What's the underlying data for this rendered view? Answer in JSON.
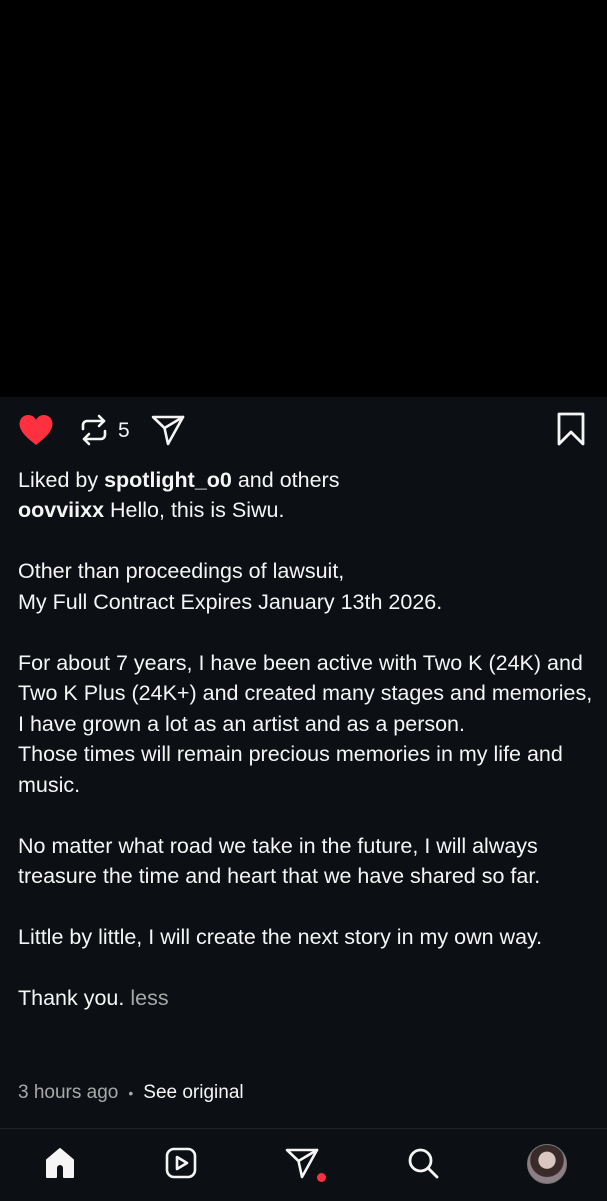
{
  "post": {
    "repost_count": "5",
    "liked_by_prefix": "Liked by ",
    "liked_by_user": "spotlight_o0",
    "liked_by_suffix": " and others",
    "author": "oovviixx",
    "caption_first": " Hello, this is Siwu.",
    "paragraphs": [
      "Other than proceedings of lawsuit,\nMy Full Contract Expires January 13th 2026.",
      "For about 7 years, I have been active with Two K (24K) and Two K Plus (24K+) and created many stages and memories,\nI have grown a lot as an artist and as a person.\nThose times will remain precious memories in my life and music.",
      "No matter what road we take in the future, I will always treasure the time and heart that we have shared so far.",
      "Little by little, I will create the next story in my own way."
    ],
    "closing": "Thank you.",
    "less_label": "less",
    "timestamp": "3 hours ago",
    "separator": "•",
    "see_original": "See original"
  },
  "icons": {
    "like": "heart-filled-icon",
    "repost": "repost-icon",
    "share": "paper-plane-icon",
    "save": "bookmark-icon"
  },
  "nav": {
    "items": [
      "home-icon",
      "reels-icon",
      "direct-message-icon",
      "search-icon",
      "profile-avatar"
    ]
  },
  "colors": {
    "background": "#0c1014",
    "media": "#000000",
    "like_red": "#ff3040",
    "muted": "#a8a8a8"
  }
}
